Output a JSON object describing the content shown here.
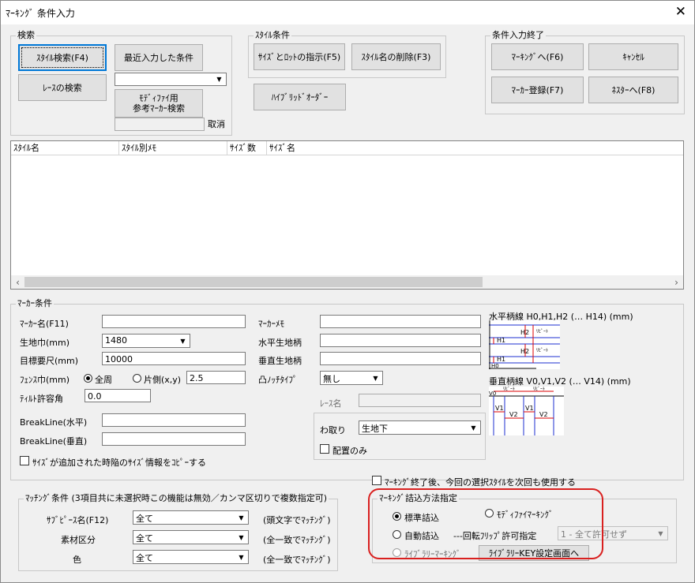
{
  "window": {
    "title": "ﾏｰｷﾝｸﾞ 条件入力",
    "close": "✕"
  },
  "search": {
    "legend": "検索",
    "style_search_btn": "ｽﾀｲﾙ検索(F4)",
    "recent_btn": "最近入力した条件",
    "race_search_btn": "ﾚｰｽの検索",
    "modify_ref_btn": "ﾓﾃﾞｨﾌｧｲ用\n参考ﾏｰｶｰ検索",
    "cancel_label": "取消"
  },
  "style_cond": {
    "legend": "ｽﾀｲﾙ条件",
    "size_lot_btn": "ｻｲｽﾞとﾛｯﾄの指示(F5)",
    "delete_style_btn": "ｽﾀｲﾙ名の削除(F3)",
    "hybrid_btn": "ﾊｲﾌﾞﾘｯﾄﾞｵｰﾀﾞｰ"
  },
  "finish": {
    "legend": "条件入力終了",
    "marking_btn": "ﾏｰｷﾝｸﾞへ(F6)",
    "cancel_btn": "ｷｬﾝｾﾙ",
    "marker_reg_btn": "ﾏｰｶｰ登録(F7)",
    "nester_btn": "ﾈｽﾀｰへ(F8)"
  },
  "list": {
    "columns": [
      "ｽﾀｲﾙ名",
      "ｽﾀｲﾙ別ﾒﾓ",
      "ｻｲｽﾞ数",
      "ｻｲｽﾞ名"
    ]
  },
  "marker": {
    "legend": "ﾏｰｶｰ条件",
    "name_label": "ﾏｰｶｰ名(F11)",
    "width_label": "生地巾(mm)",
    "width_value": "1480",
    "length_label": "目標要尺(mm)",
    "length_value": "10000",
    "fence_label": "ﾌｪﾝｽ巾(mm)",
    "fence_all": "全周",
    "fence_side": "片側(x,y)",
    "fence_value": "2.5",
    "tilt_label": "ﾃｨﾙﾄ許容角",
    "tilt_value": "0.0",
    "break_h_label": "BreakLine(水平)",
    "break_v_label": "BreakLine(垂直)",
    "size_copy_label": "ｻｲｽﾞが追加された時陥のｻｲｽﾞ情報をｺﾋﾟｰする",
    "memo_label": "ﾏｰｶｰﾒﾓ",
    "h_pattern_label": "水平生地柄",
    "v_pattern_label": "垂直生地柄",
    "notch_label": "凸ﾉｯﾁﾀｲﾌﾟ",
    "notch_value": "無し",
    "race_label": "ﾚｰｽ名",
    "wadori_label": "わ取り",
    "wadori_value": "生地下",
    "layout_only_label": "配置のみ",
    "h_diag_title": "水平柄線  H0,H1,H2 (… H14) (mm)",
    "v_diag_title": "垂直柄線  V0,V1,V2 (… V14) (mm)",
    "diag_repeat": "ﾘﾋﾟｰﾄ",
    "diag_h": [
      "H2",
      "H1",
      "H2",
      "H1",
      "H0"
    ],
    "diag_v": [
      "V0",
      "V1",
      "V2",
      "V1",
      "V2"
    ]
  },
  "matching": {
    "legend": "ﾏｯﾁﾝｸﾞ条件  (3項目共に未選択時この機能は無効／カンマ区切りで複数指定可)",
    "rows": [
      {
        "label": "ｻﾌﾞﾋﾟｰｽ名(F12)",
        "value": "全て",
        "note": "(頭文字でﾏｯﾁﾝｸﾞ)"
      },
      {
        "label": "素材区分",
        "value": "全て",
        "note": "(全一致でﾏｯﾁﾝｸﾞ)"
      },
      {
        "label": "色",
        "value": "全て",
        "note": "(全一致でﾏｯﾁﾝｸﾞ)"
      }
    ]
  },
  "reuse_label": "ﾏｰｷﾝｸﾞ終了後、今回の選択ｽﾀｲﾙを次回も使用する",
  "packing": {
    "legend": "ﾏｰｷﾝｸﾞ詰込方法指定",
    "standard": "標準詰込",
    "modify": "ﾓﾃﾞｨﾌｧｲﾏｰｷﾝｸﾞ",
    "auto": "自動詰込",
    "flip_label": "---回転ﾌﾘｯﾌﾟ許可指定",
    "flip_value": "1 - 全て許可せず",
    "library": "ﾗｲﾌﾞﾗﾘｰﾏｰｷﾝｸﾞ",
    "library_btn": "ﾗｲﾌﾞﾗﾘｰKEY設定画面へ"
  },
  "colors": {
    "accent": "#0078d7",
    "highlight": "#d9201f"
  }
}
